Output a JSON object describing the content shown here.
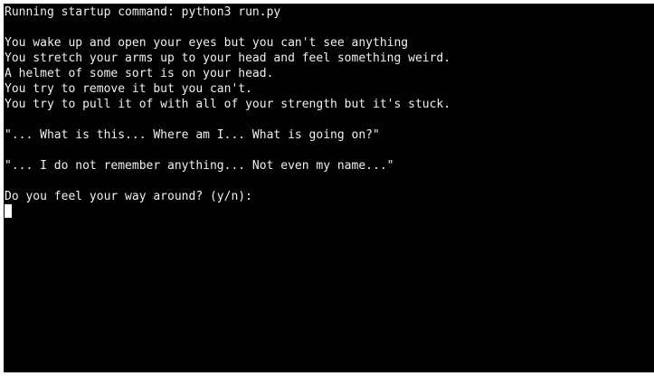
{
  "terminal": {
    "lines": [
      "Running startup command: python3 run.py",
      "",
      "You wake up and open your eyes but you can't see anything",
      "You stretch your arms up to your head and feel something weird.",
      "A helmet of some sort is on your head.",
      "You try to remove it but you can't.",
      "You try to pull it of with all of your strength but it's stuck.",
      "",
      "\"... What is this... Where am I... What is going on?\"",
      "",
      "\"... I do not remember anything... Not even my name...\"",
      "",
      "Do you feel your way around? (y/n):"
    ],
    "input_value": ""
  }
}
